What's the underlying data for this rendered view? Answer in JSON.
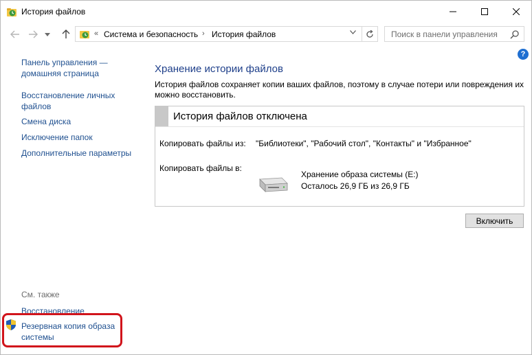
{
  "window": {
    "title": "История файлов",
    "controls": {
      "minimize": "–",
      "maximize": "☐",
      "close": "✕"
    }
  },
  "nav": {
    "back_icon": "arrow-left-icon",
    "forward_icon": "arrow-right-icon",
    "up_icon": "arrow-up-icon"
  },
  "address": {
    "separator": "«",
    "crumbs": [
      "Система и безопасность",
      "История файлов"
    ],
    "crumb_separator": "›"
  },
  "search": {
    "placeholder": "Поиск в панели управления"
  },
  "sidebar": {
    "items": [
      "Панель управления — домашняя страница",
      "Восстановление личных файлов",
      "Смена диска",
      "Исключение папок",
      "Дополнительные параметры"
    ],
    "see_also_label": "См. также",
    "see_also": [
      "Восстановление",
      "Резервная копия образа системы"
    ]
  },
  "main": {
    "heading": "Хранение истории файлов",
    "description": "История файлов сохраняет копии ваших файлов, поэтому в случае потери или повреждения их можно восстановить.",
    "status_title": "История файлов отключена",
    "copy_from_label": "Копировать файлы из:",
    "copy_from_value": "\"Библиотеки\", \"Рабочий стол\", \"Контакты\" и \"Избранное\"",
    "copy_to_label": "Копировать файлы в:",
    "drive_name": "Хранение образа системы (E:)",
    "drive_space": "Осталось 26,9 ГБ из 26,9 ГБ",
    "enable_button": "Включить"
  },
  "colors": {
    "link": "#1e4f8f",
    "heading": "#1e3f8a",
    "highlight": "#d1141b"
  }
}
